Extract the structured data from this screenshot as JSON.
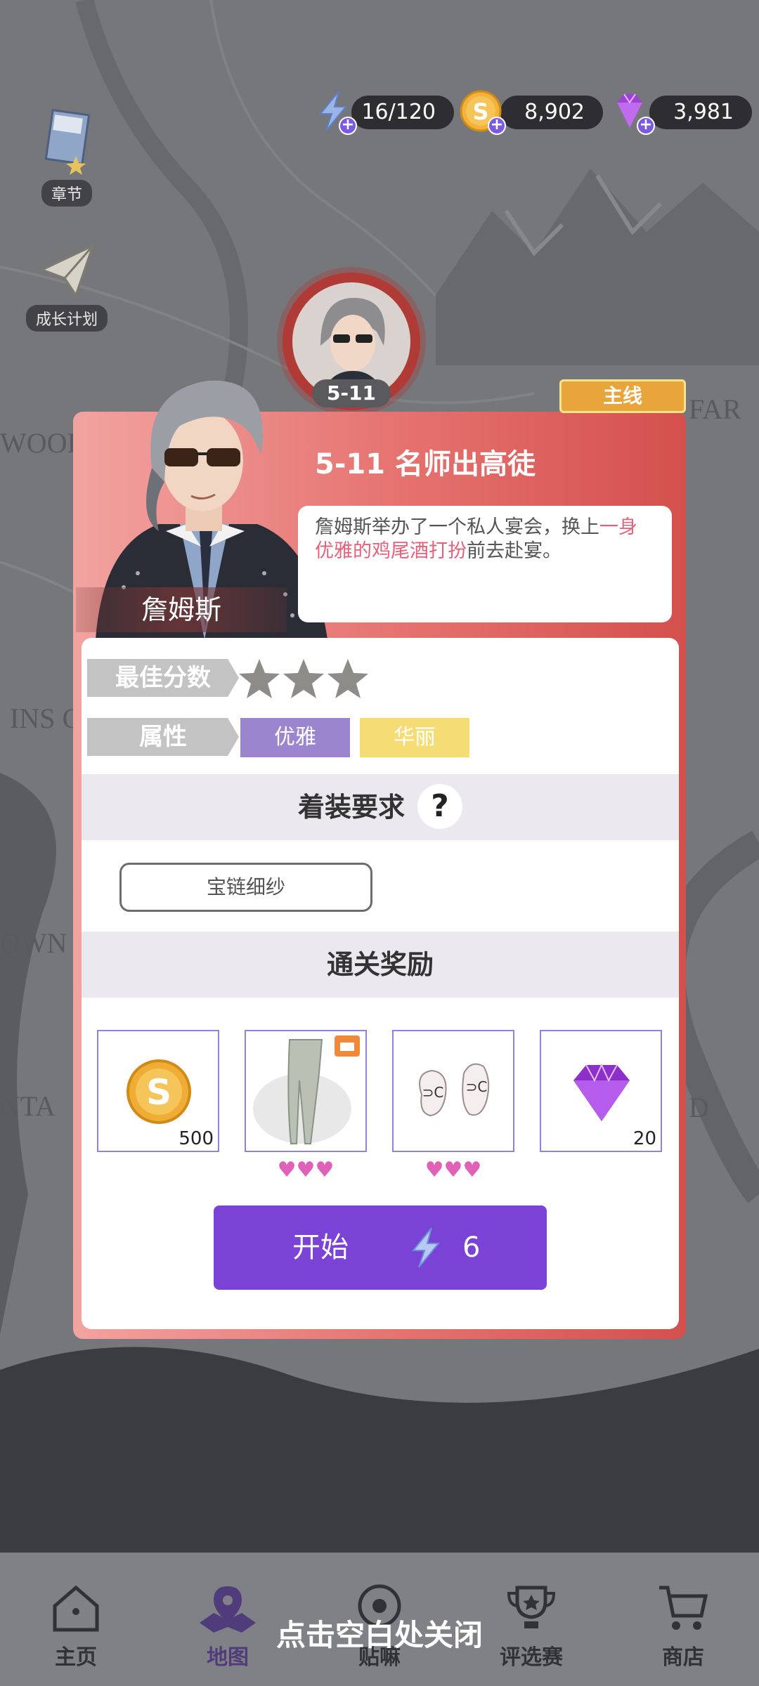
{
  "resources": {
    "energy": "16/120",
    "coins": "8,902",
    "gems": "3,981"
  },
  "side": {
    "chapter_label": "章节",
    "growth_label": "成长计划"
  },
  "marker": {
    "level": "5-11"
  },
  "panel": {
    "ribbon": "主线",
    "level_title": "5-11  名师出高徒",
    "description_part1": "詹姆斯举办了一个私人宴会，换上",
    "description_highlight": "一身优雅的鸡尾酒打扮",
    "description_part2": "前去赴宴。",
    "character_name": "詹姆斯",
    "best_score_label": "最佳分数",
    "stars": 3,
    "attribute_label": "属性",
    "attributes": [
      "优雅",
      "华丽"
    ],
    "dress_requirement_title": "着装要求",
    "help_glyph": "?",
    "requirement": "宝链细纱",
    "rewards_title": "通关奖励",
    "rewards": [
      {
        "icon": "coin-icon",
        "qty": "500"
      },
      {
        "icon": "pants-icon",
        "qty": "",
        "hearts": "♥♥♥"
      },
      {
        "icon": "sandals-icon",
        "qty": "",
        "hearts": "♥♥♥"
      },
      {
        "icon": "gem-icon",
        "qty": "20"
      }
    ],
    "start_label": "开始",
    "start_cost": "6"
  },
  "nav": {
    "items": [
      "主页",
      "地图",
      "贴嘛",
      "评选赛",
      "商店"
    ],
    "active": "地图"
  },
  "close_hint": "点击空白处关闭",
  "colors": {
    "panel_red": "#e5716e",
    "start_purple": "#7b43d5",
    "tag_elegant": "#9c85cf",
    "tag_gorgeous": "#f6dc74",
    "ribbon": "#e8a53c",
    "highlight": "#e2627b"
  }
}
